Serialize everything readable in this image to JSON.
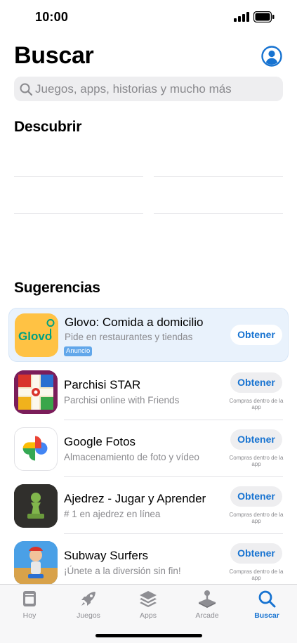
{
  "status_bar": {
    "time": "10:00"
  },
  "header": {
    "title": "Buscar"
  },
  "search": {
    "placeholder": "Juegos, apps, historias y mucho más"
  },
  "discover": {
    "title": "Descubrir"
  },
  "suggestions": {
    "title": "Sugerencias",
    "items": [
      {
        "name": "Glovo: Comida a domicilio",
        "subtitle": "Pide en restaurantes y tiendas",
        "badge": "Anuncio",
        "button": "Obtener",
        "icon": "glovo-icon",
        "icon_text": "Glovo"
      },
      {
        "name": "Parchisi STAR",
        "subtitle": "Parchisi online with Friends",
        "button": "Obtener",
        "note": "Compras dentro de la app",
        "icon": "parchisi-icon"
      },
      {
        "name": "Google Fotos",
        "subtitle": "Almacenamiento de foto y vídeo",
        "button": "Obtener",
        "note": "Compras dentro de la app",
        "icon": "google-photos-icon"
      },
      {
        "name": "Ajedrez - Jugar y Aprender",
        "subtitle": "# 1 en ajedrez en línea",
        "button": "Obtener",
        "note": "Compras dentro de la app",
        "icon": "chess-icon"
      },
      {
        "name": "Subway Surfers",
        "subtitle": "¡Únete a la diversión sin fin!",
        "button": "Obtener",
        "note": "Compras dentro de la app",
        "icon": "subway-surfers-icon"
      }
    ]
  },
  "tab_bar": {
    "tabs": [
      {
        "label": "Hoy",
        "icon": "today-icon",
        "active": false
      },
      {
        "label": "Juegos",
        "icon": "rocket-icon",
        "active": false
      },
      {
        "label": "Apps",
        "icon": "layers-icon",
        "active": false
      },
      {
        "label": "Arcade",
        "icon": "joystick-icon",
        "active": false
      },
      {
        "label": "Buscar",
        "icon": "search-icon",
        "active": true
      }
    ]
  },
  "colors": {
    "accent": "#1773d1",
    "ad_background": "#e9f2fc",
    "glovo_yellow": "#ffc244",
    "glovo_green": "#00a082"
  }
}
